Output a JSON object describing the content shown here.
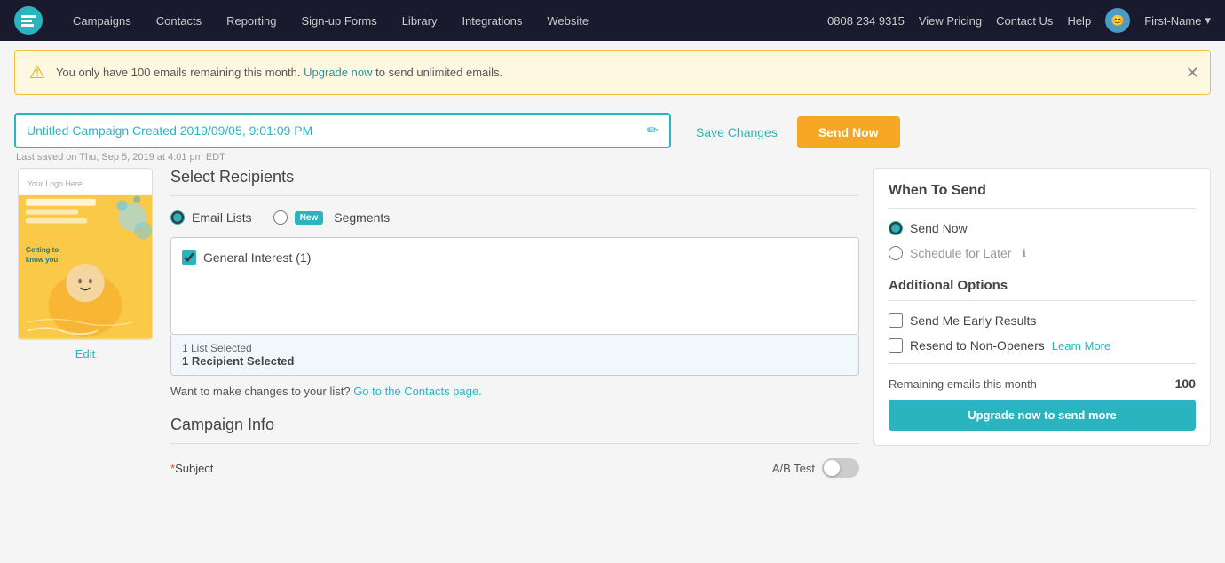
{
  "nav": {
    "logo_alt": "Flashissue Logo",
    "links": [
      "Campaigns",
      "Contacts",
      "Reporting",
      "Sign-up Forms",
      "Library",
      "Integrations",
      "Website"
    ],
    "phone": "0808 234 9315",
    "view_pricing": "View Pricing",
    "contact_us": "Contact Us",
    "help": "Help",
    "username": "First-Name"
  },
  "alert": {
    "text_before": "You only have 100 emails remaining this month.",
    "link_text": "Upgrade now",
    "text_after": "to send unlimited emails."
  },
  "header": {
    "campaign_title": "Untitled Campaign Created 2019/09/05, 9:01:09 PM",
    "last_saved": "Last saved on Thu, Sep 5, 2019 at 4:01 pm EDT",
    "save_changes_label": "Save Changes",
    "send_now_label": "Send Now"
  },
  "preview": {
    "edit_label": "Edit"
  },
  "recipients": {
    "section_title": "Select Recipients",
    "radio_email_lists": "Email Lists",
    "badge_new": "New",
    "radio_segments": "Segments",
    "list_items": [
      {
        "label": "General Interest (1)",
        "checked": true
      }
    ],
    "selected_count": "1 List Selected",
    "selected_recipients": "1 Recipient Selected",
    "contacts_text": "Want to make changes to your list?",
    "contacts_link_text": "Go to the Contacts page.",
    "contacts_link_href": "#"
  },
  "campaign_info": {
    "section_title": "Campaign Info",
    "subject_label": "Subject",
    "subject_required": "*",
    "ab_test_label": "A/B Test"
  },
  "when_to_send": {
    "panel_title": "When To Send",
    "send_now_label": "Send Now",
    "schedule_later_label": "Schedule for Later",
    "schedule_info": "ℹ",
    "additional_title": "Additional Options",
    "send_early_label": "Send Me Early Results",
    "resend_label": "Resend to Non-Openers",
    "learn_more": "Learn More",
    "remaining_label": "Remaining emails this month",
    "remaining_count": "100",
    "upgrade_label": "Upgrade now to send more"
  }
}
